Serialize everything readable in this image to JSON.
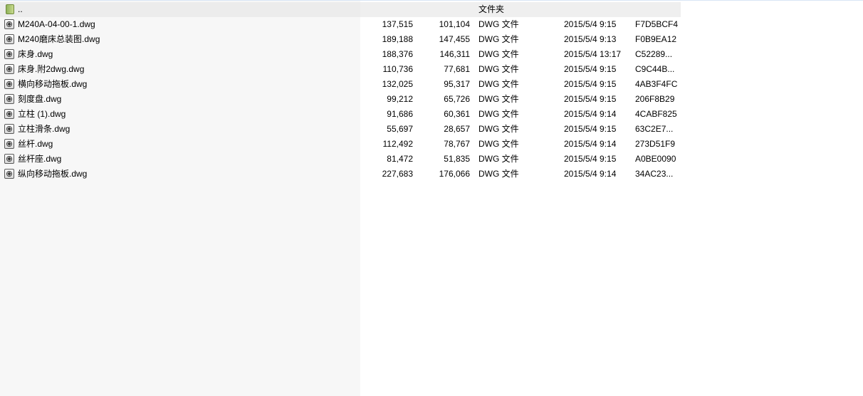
{
  "parent_row": {
    "name": "..",
    "type": "文件夹"
  },
  "files": [
    {
      "name": "M240A-04-00-1.dwg",
      "size": "137,515",
      "packed": "101,104",
      "type": "DWG 文件",
      "modified": "2015/5/4 9:15",
      "crc": "F7D5BCF4"
    },
    {
      "name": "M240磨床总装图.dwg",
      "size": "189,188",
      "packed": "147,455",
      "type": "DWG 文件",
      "modified": "2015/5/4 9:13",
      "crc": "F0B9EA12"
    },
    {
      "name": "床身.dwg",
      "size": "188,376",
      "packed": "146,311",
      "type": "DWG 文件",
      "modified": "2015/5/4 13:17",
      "crc": "C52289..."
    },
    {
      "name": "床身.附2dwg.dwg",
      "size": "110,736",
      "packed": "77,681",
      "type": "DWG 文件",
      "modified": "2015/5/4 9:15",
      "crc": "C9C44B..."
    },
    {
      "name": "横向移动拖板.dwg",
      "size": "132,025",
      "packed": "95,317",
      "type": "DWG 文件",
      "modified": "2015/5/4 9:15",
      "crc": "4AB3F4FC"
    },
    {
      "name": "刻度盘.dwg",
      "size": "99,212",
      "packed": "65,726",
      "type": "DWG 文件",
      "modified": "2015/5/4 9:15",
      "crc": "206F8B29"
    },
    {
      "name": "立柱 (1).dwg",
      "size": "91,686",
      "packed": "60,361",
      "type": "DWG 文件",
      "modified": "2015/5/4 9:14",
      "crc": "4CABF825"
    },
    {
      "name": "立柱滑条.dwg",
      "size": "55,697",
      "packed": "28,657",
      "type": "DWG 文件",
      "modified": "2015/5/4 9:15",
      "crc": "63C2E7..."
    },
    {
      "name": "丝杆.dwg",
      "size": "112,492",
      "packed": "78,767",
      "type": "DWG 文件",
      "modified": "2015/5/4 9:14",
      "crc": "273D51F9"
    },
    {
      "name": "丝杆座.dwg",
      "size": "81,472",
      "packed": "51,835",
      "type": "DWG 文件",
      "modified": "2015/5/4 9:15",
      "crc": "A0BE0090"
    },
    {
      "name": "纵向移动拖板.dwg",
      "size": "227,683",
      "packed": "176,066",
      "type": "DWG 文件",
      "modified": "2015/5/4 9:14",
      "crc": "34AC23..."
    }
  ]
}
